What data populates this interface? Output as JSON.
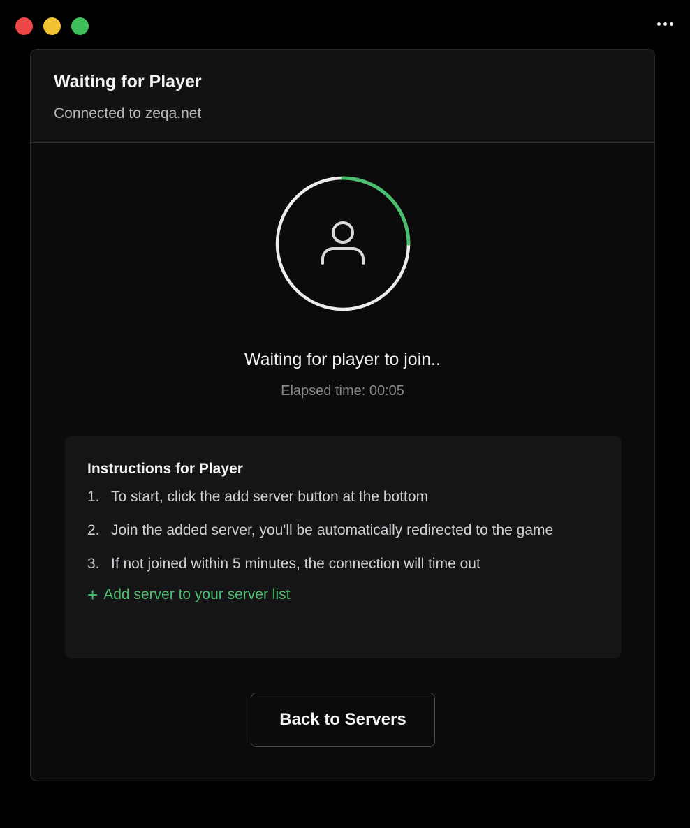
{
  "window": {
    "controls": [
      "close",
      "minimize",
      "maximize"
    ],
    "menu_icon": "more-horizontal-icon"
  },
  "header": {
    "title": "Waiting for Player",
    "subtitle": "Connected to zeqa.net"
  },
  "status": {
    "progress": 0.25,
    "icon": "user-icon",
    "message": "Waiting for player to join..",
    "elapsed": "Elapsed time: 00:05"
  },
  "instructions": {
    "title": "Instructions for Player",
    "steps": [
      {
        "num": "1.",
        "text": "To start, click the add server button at the bottom"
      },
      {
        "num": "2.",
        "text": "Join the added server, you'll be automatically redirected to the game"
      },
      {
        "num": "3.",
        "text": "If not joined within 5 minutes, the connection will time out"
      }
    ],
    "add_server_label": "Add server to your server list"
  },
  "actions": {
    "back_label": "Back to Servers"
  },
  "colors": {
    "accent_green": "#4cbf6e",
    "progress_track": "#ececec",
    "background": "#000000",
    "card": "#0b0b0c"
  }
}
